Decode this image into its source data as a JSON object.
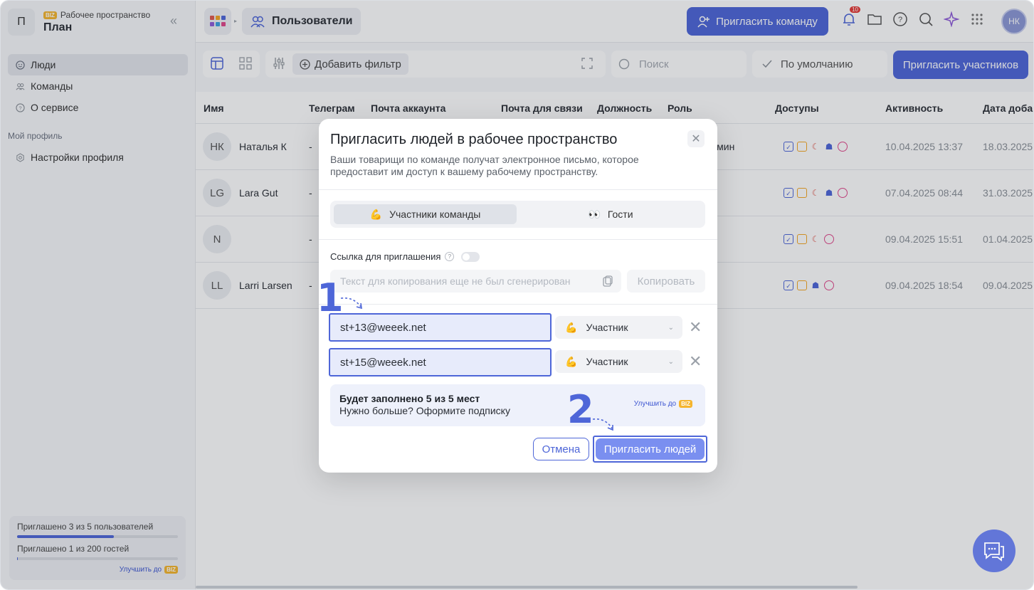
{
  "sidebar": {
    "workspace_initial": "П",
    "workspace_badge": "BIZ",
    "workspace_label": "Рабочее пространство",
    "workspace_name": "План",
    "nav": [
      {
        "label": "Люди",
        "icon": "smile-icon"
      },
      {
        "label": "Команды",
        "icon": "people-icon"
      },
      {
        "label": "О сервисе",
        "icon": "help-icon"
      }
    ],
    "profile_section": "Мой профиль",
    "profile_item": "Настройки профиля",
    "quota": {
      "users_text": "Приглашено 3 из 5 пользователей",
      "users_progress": 0.6,
      "guests_text": "Приглашено 1 из 200 гостей",
      "guests_progress": 0.005,
      "upgrade_text": "Улучшить до",
      "upgrade_badge": "BIZ"
    }
  },
  "header": {
    "breadcrumb": "Пользователи",
    "invite_team_label": "Пригласить команду",
    "notifications_count": "10",
    "user_initials": "НК"
  },
  "toolbar": {
    "add_filter_label": "Добавить фильтр",
    "search_placeholder": "Поиск",
    "sort_label": "По умолчанию",
    "invite_members_label": "Пригласить участников"
  },
  "table": {
    "columns": [
      "Имя",
      "Телеграм",
      "Почта аккаунта",
      "Почта для связи",
      "Должность",
      "Роль",
      "Доступы",
      "Активность",
      "Дата доба"
    ],
    "rows": [
      {
        "initials": "НК",
        "name": "Наталья К",
        "telegram": "-",
        "role": "дмин",
        "activity": "10.04.2025 13:37",
        "date": "18.03.2025"
      },
      {
        "initials": "LG",
        "name": "Lara Gut",
        "telegram": "-",
        "role": "",
        "activity": "07.04.2025 08:44",
        "date": "31.03.2025"
      },
      {
        "initials": "N",
        "name": "",
        "telegram": "-",
        "role": "",
        "activity": "09.04.2025 15:51",
        "date": "01.04.2025"
      },
      {
        "initials": "LL",
        "name": "Larri Larsen",
        "telegram": "-",
        "role": "",
        "activity": "09.04.2025 18:54",
        "date": "09.04.2025"
      }
    ]
  },
  "modal": {
    "title": "Пригласить людей в рабочее пространство",
    "description": "Ваши товарищи по команде получат электронное письмо, которое предоставит им доступ к вашему рабочему пространству.",
    "tab_members": "Участники команды",
    "tab_guests": "Гости",
    "link_label": "Ссылка для приглашения",
    "link_placeholder": "Текст для копирования еще не был сгенерирован",
    "copy_label": "Копировать",
    "invites": [
      {
        "email": "st+13@weeek.net",
        "role": "Участник"
      },
      {
        "email": "st+15@weeek.net",
        "role": "Участник"
      }
    ],
    "note_title": "Будет заполнено 5 из 5 мест",
    "note_subtitle": "Нужно больше? Оформите подписку",
    "note_upgrade": "Улучшить до",
    "note_badge": "BIZ",
    "cancel_label": "Отмена",
    "submit_label": "Пригласить людей"
  },
  "steps": {
    "one": "1",
    "two": "2"
  },
  "colors": {
    "accent": "#4e66d8",
    "biz_badge": "#f5b52e"
  }
}
